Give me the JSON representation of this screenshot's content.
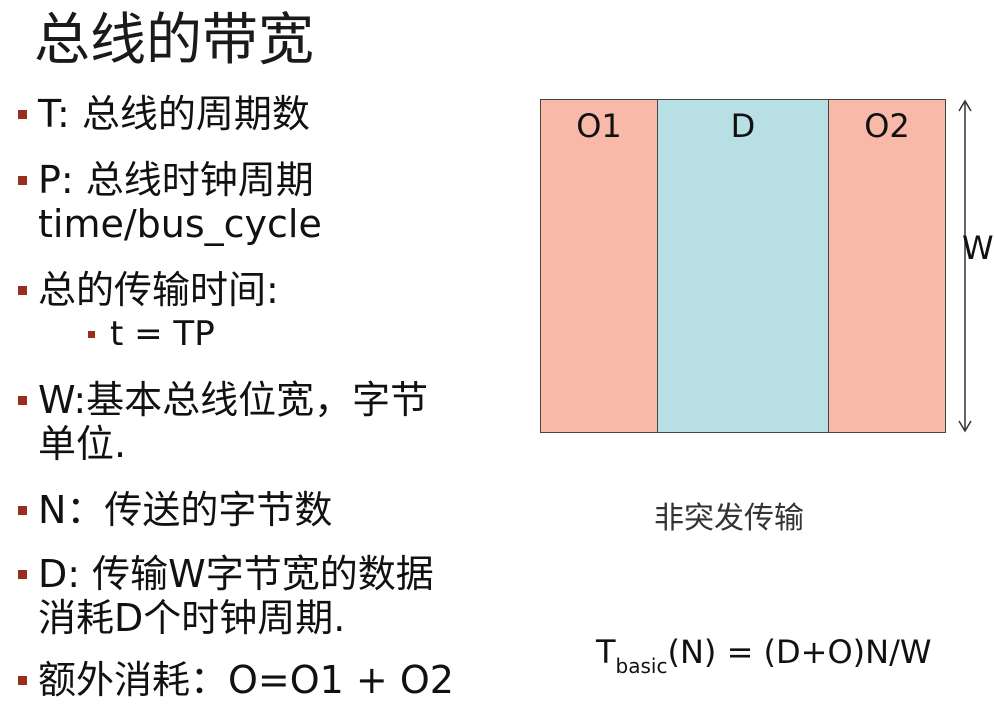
{
  "title": "总线的带宽",
  "bullets": [
    {
      "lines": [
        "T: 总线的周期数"
      ]
    },
    {
      "lines": [
        "P: 总线时钟周期",
        "time/bus_cycle"
      ]
    },
    {
      "lines": [
        "总的传输时间:"
      ],
      "sub": "t = TP"
    },
    {
      "lines": [
        "W:基本总线位宽，字节",
        "单位."
      ]
    },
    {
      "lines": [
        "N：传送的字节数"
      ]
    },
    {
      "lines": [
        "D: 传输W字节宽的数据",
        "消耗D个时钟周期."
      ]
    },
    {
      "lines": [
        "额外消耗：O=O1 + O2"
      ]
    }
  ],
  "diagram": {
    "segments": [
      {
        "label": "O1",
        "color": "#f9b9a9"
      },
      {
        "label": "D",
        "color": "#b8dfe3"
      },
      {
        "label": "O2",
        "color": "#f9b9a9"
      }
    ],
    "w_label": "W",
    "caption": "非突发传输"
  },
  "formula": {
    "base": "T",
    "subscript": "basic",
    "rest": "(N) = (D+O)N/W"
  },
  "colors": {
    "bullet": "#9b2d1f",
    "overhead": "#f9b9a9",
    "data": "#b8dfe3"
  }
}
